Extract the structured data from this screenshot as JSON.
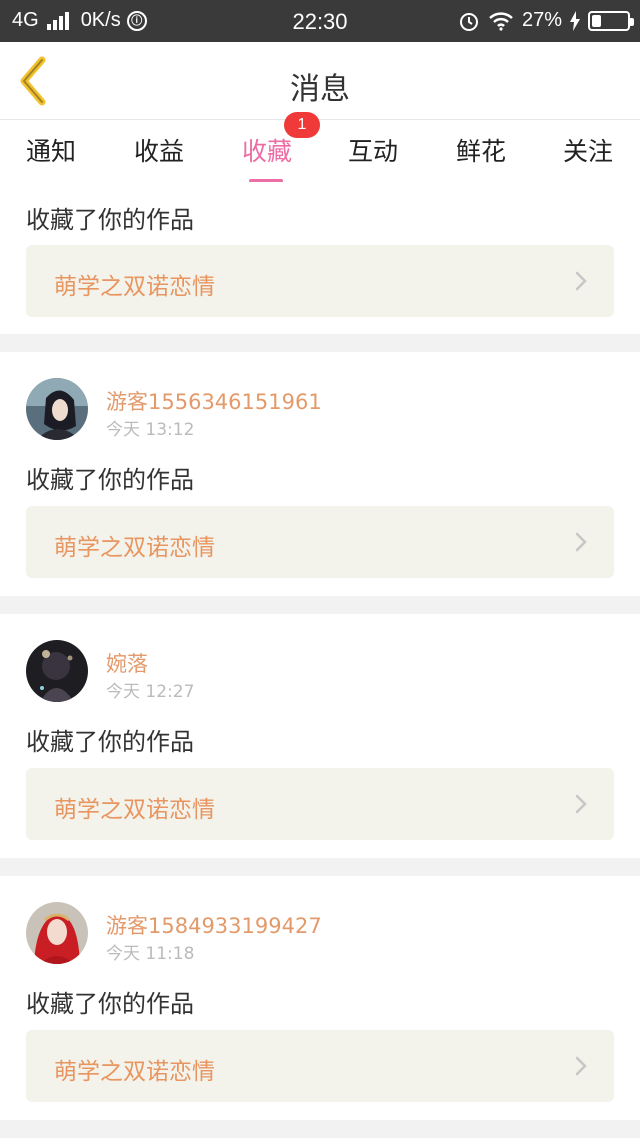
{
  "status_bar": {
    "network": "4G",
    "speed": "0K/s",
    "time": "22:30",
    "battery": "27%",
    "battery_level": 0.27
  },
  "header": {
    "title": "消息",
    "back_icon": "chevron-left-icon",
    "accent": "#f2c12e"
  },
  "tabs": {
    "items": [
      {
        "label": "通知"
      },
      {
        "label": "收益"
      },
      {
        "label": "收藏"
      },
      {
        "label": "互动"
      },
      {
        "label": "鲜花"
      },
      {
        "label": "关注"
      }
    ],
    "active": "收藏",
    "active_color": "#ec6ea4",
    "badge": "1"
  },
  "messages": [
    {
      "action": "收藏了你的作品",
      "work_title": "萌学之双诺恋情"
    },
    {
      "username": "游客1556346151961",
      "time": "今天 13:12",
      "action": "收藏了你的作品",
      "work_title": "萌学之双诺恋情"
    },
    {
      "username": "婉落",
      "time": "今天 12:27",
      "action": "收藏了你的作品",
      "work_title": "萌学之双诺恋情"
    },
    {
      "username": "游客1584933199427",
      "time": "今天 11:18",
      "action": "收藏了你的作品",
      "work_title": "萌学之双诺恋情"
    }
  ]
}
